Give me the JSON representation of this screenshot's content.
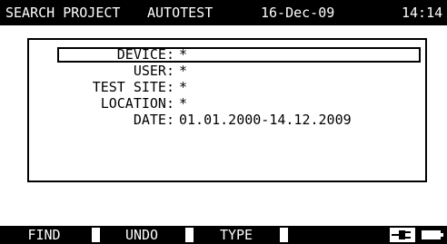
{
  "header": {
    "screen_title": "SEARCH PROJECT",
    "mode": "AUTOTEST",
    "date": "16-Dec-09",
    "time": "14:14"
  },
  "filters": [
    {
      "label": "DEVICE:",
      "value": "*"
    },
    {
      "label": "USER:",
      "value": "*"
    },
    {
      "label": "TEST SITE:",
      "value": "*"
    },
    {
      "label": "LOCATION:",
      "value": "*"
    },
    {
      "label": "DATE:",
      "value": "01.01.2000-14.12.2009"
    }
  ],
  "softkeys": {
    "find": "FIND",
    "undo": "UNDO",
    "type": "TYPE"
  },
  "status_icons": {
    "power": "mains-plug-icon",
    "battery": "battery-icon"
  }
}
